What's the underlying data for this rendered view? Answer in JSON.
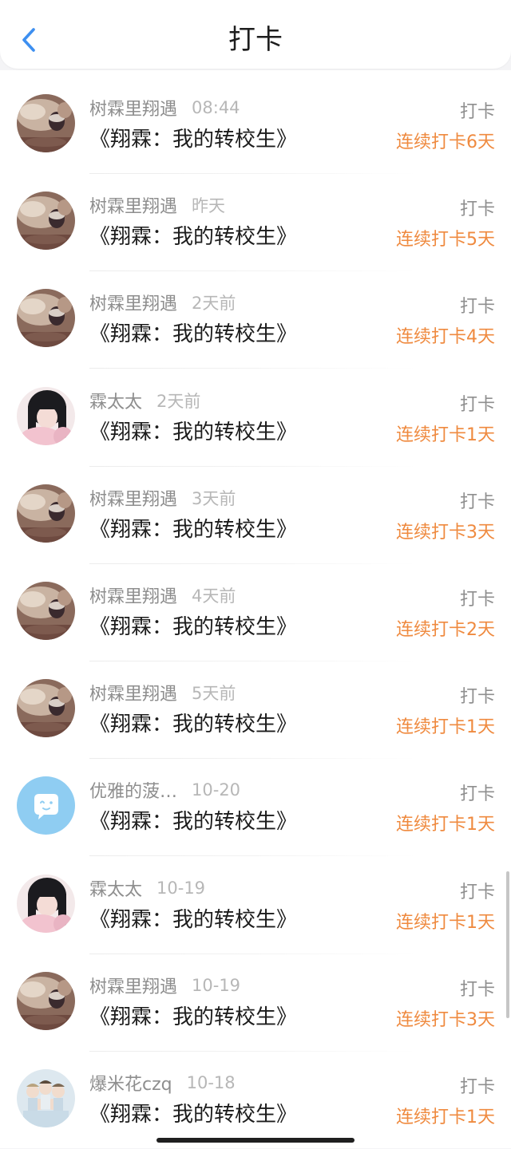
{
  "header": {
    "title": "打卡",
    "back_icon": "chevron-left-icon",
    "accent_color": "#3d8ff0"
  },
  "colors": {
    "streak": "#ef8a3f",
    "username": "#8e8e8e",
    "time": "#b7b7b7"
  },
  "entries": [
    {
      "user": "树霖里翔遇",
      "time": "08:44",
      "avatar": "photo-avatar-drinks",
      "book": "《翔霖：我的转校生》",
      "action": "打卡",
      "streak": "连续打卡6天"
    },
    {
      "user": "树霖里翔遇",
      "time": "昨天",
      "avatar": "photo-avatar-drinks",
      "book": "《翔霖：我的转校生》",
      "action": "打卡",
      "streak": "连续打卡5天"
    },
    {
      "user": "树霖里翔遇",
      "time": "2天前",
      "avatar": "photo-avatar-drinks",
      "book": "《翔霖：我的转校生》",
      "action": "打卡",
      "streak": "连续打卡4天"
    },
    {
      "user": "霖太太",
      "time": "2天前",
      "avatar": "photo-avatar-girl",
      "book": "《翔霖：我的转校生》",
      "action": "打卡",
      "streak": "连续打卡1天"
    },
    {
      "user": "树霖里翔遇",
      "time": "3天前",
      "avatar": "photo-avatar-drinks",
      "book": "《翔霖：我的转校生》",
      "action": "打卡",
      "streak": "连续打卡3天"
    },
    {
      "user": "树霖里翔遇",
      "time": "4天前",
      "avatar": "photo-avatar-drinks",
      "book": "《翔霖：我的转校生》",
      "action": "打卡",
      "streak": "连续打卡2天"
    },
    {
      "user": "树霖里翔遇",
      "time": "5天前",
      "avatar": "photo-avatar-drinks",
      "book": "《翔霖：我的转校生》",
      "action": "打卡",
      "streak": "连续打卡1天"
    },
    {
      "user": "优雅的菠…",
      "time": "10-20",
      "avatar": "default-avatar-bubble",
      "book": "《翔霖：我的转校生》",
      "action": "打卡",
      "streak": "连续打卡1天"
    },
    {
      "user": "霖太太",
      "time": "10-19",
      "avatar": "photo-avatar-girl",
      "book": "《翔霖：我的转校生》",
      "action": "打卡",
      "streak": "连续打卡1天"
    },
    {
      "user": "树霖里翔遇",
      "time": "10-19",
      "avatar": "photo-avatar-drinks",
      "book": "《翔霖：我的转校生》",
      "action": "打卡",
      "streak": "连续打卡3天"
    },
    {
      "user": "爆米花czq",
      "time": "10-18",
      "avatar": "photo-avatar-group",
      "book": "《翔霖：我的转校生》",
      "action": "打卡",
      "streak": "连续打卡1天"
    }
  ]
}
